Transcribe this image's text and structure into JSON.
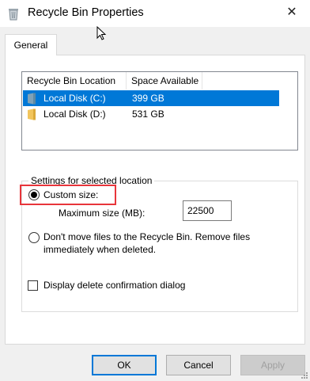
{
  "window": {
    "title": "Recycle Bin Properties",
    "close_glyph": "✕"
  },
  "tabs": [
    {
      "label": "General",
      "selected": true
    }
  ],
  "list": {
    "columns": [
      "Recycle Bin Location",
      "Space Available"
    ],
    "rows": [
      {
        "name": "Local Disk (C:)",
        "space": "399 GB",
        "selected": true,
        "icon": "system-drive-icon"
      },
      {
        "name": "Local Disk (D:)",
        "space": "531 GB",
        "selected": false,
        "icon": "folder-drive-icon"
      }
    ]
  },
  "settings": {
    "group_label": "Settings for selected location",
    "custom_size_label": "Custom size:",
    "custom_size_selected": true,
    "max_size_label": "Maximum size (MB):",
    "max_size_value": "22500",
    "dont_move_label_line1": "Don't move files to the Recycle Bin. Remove files",
    "dont_move_label_line2": "immediately when deleted.",
    "dont_move_selected": false
  },
  "confirm_dialog": {
    "label": "Display delete confirmation dialog",
    "checked": false
  },
  "buttons": {
    "ok": "OK",
    "cancel": "Cancel",
    "apply": "Apply"
  },
  "colors": {
    "accent": "#0078d7",
    "highlight": "#e8353b"
  }
}
